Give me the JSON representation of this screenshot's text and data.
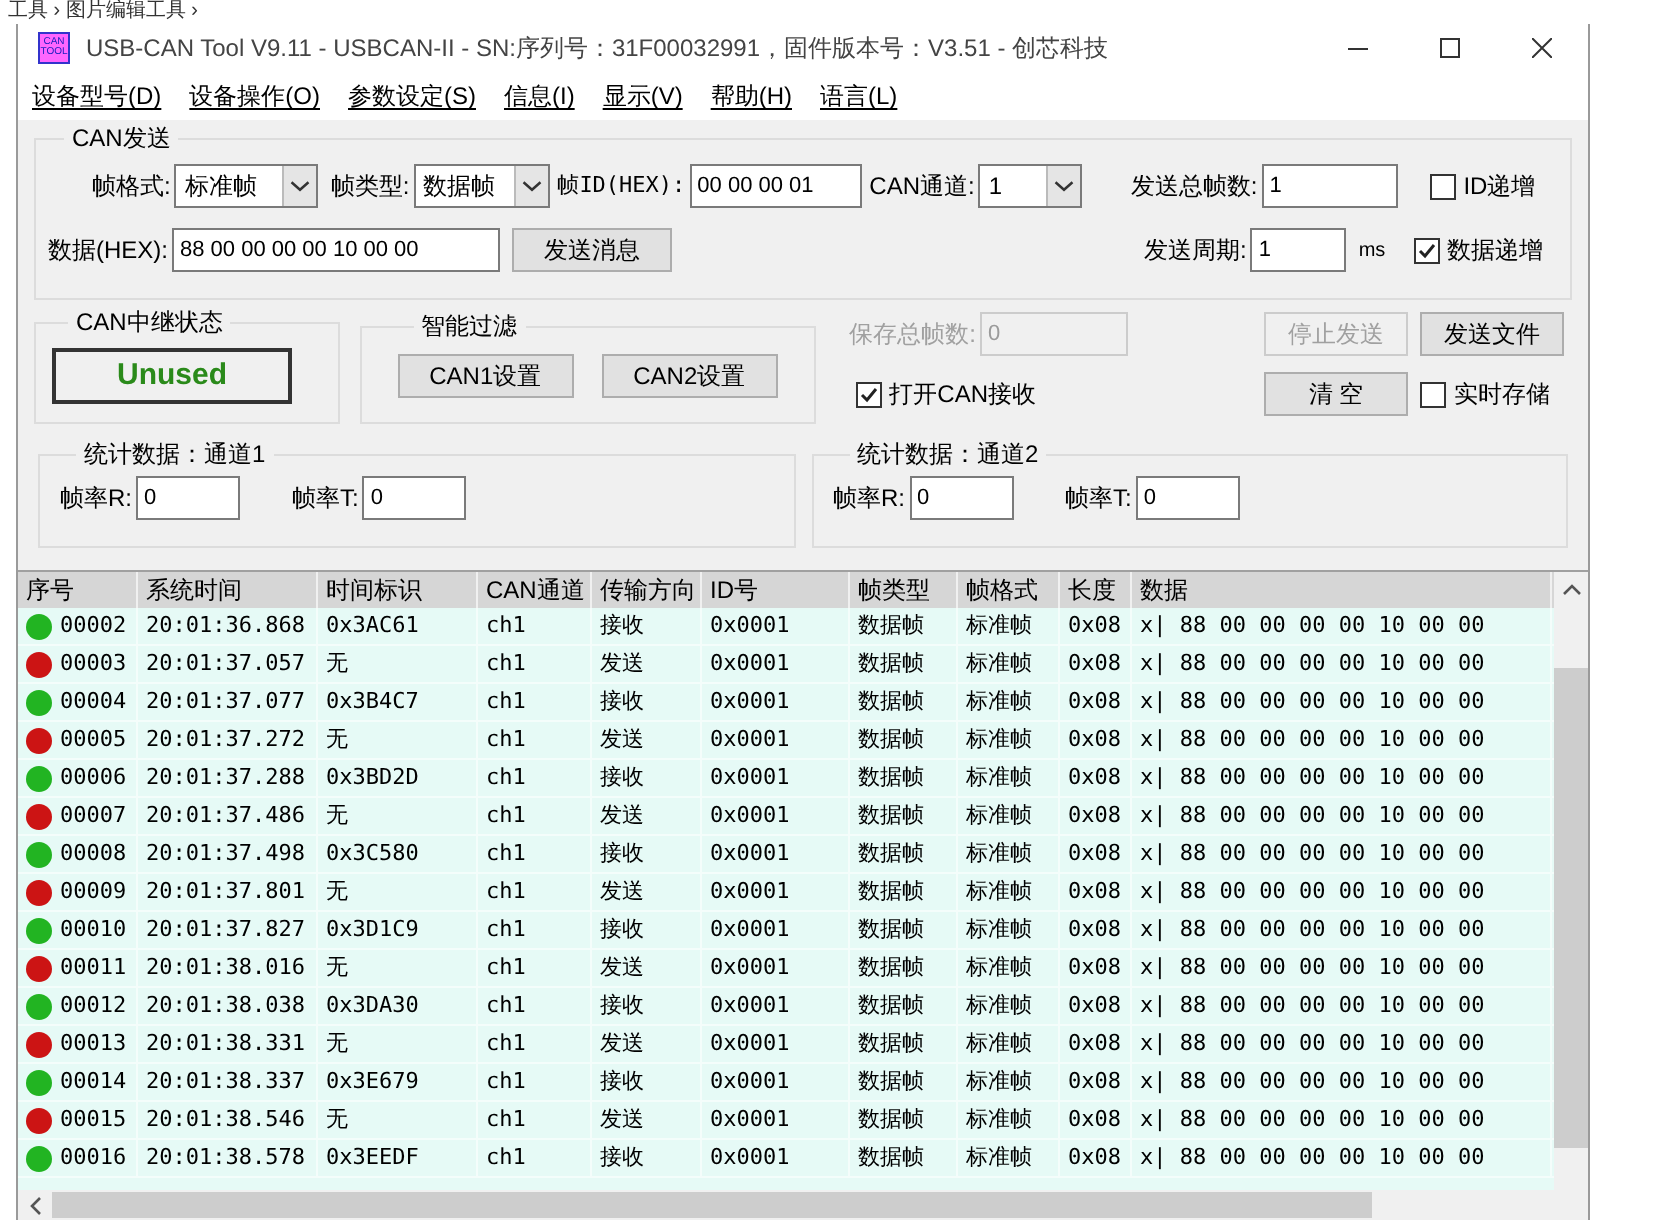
{
  "background_breadcrumb": "工具 › 图片编辑工具 ›",
  "window": {
    "title": "USB-CAN Tool V9.11 - USBCAN-II - SN:序列号：31F00032991，固件版本号：V3.51 - 创芯科技",
    "logo": "CAN TOOL"
  },
  "menu": [
    "设备型号(D)",
    "设备操作(O)",
    "参数设定(S)",
    "信息(I)",
    "显示(V)",
    "帮助(H)",
    "语言(L)"
  ],
  "can_send": {
    "title": "CAN发送",
    "frame_format": {
      "label": "帧格式:",
      "value": "标准帧"
    },
    "frame_type": {
      "label": "帧类型:",
      "value": "数据帧"
    },
    "frame_id": {
      "label": "帧ID(HEX):",
      "value": "00 00 00 01"
    },
    "channel": {
      "label": "CAN通道:",
      "value": "1"
    },
    "total_frames": {
      "label": "发送总帧数:",
      "value": "1"
    },
    "id_increment": {
      "label": "ID递增",
      "checked": false
    },
    "data": {
      "label": "数据(HEX):",
      "value": "88 00 00 00 00 10 00 00"
    },
    "send_button": "发送消息",
    "period": {
      "label": "发送周期:",
      "value": "1",
      "unit": "ms"
    },
    "data_increment": {
      "label": "数据递增",
      "checked": true
    }
  },
  "relay": {
    "title": "CAN中继状态",
    "status": "Unused"
  },
  "filter": {
    "title": "智能过滤",
    "buttons": [
      "CAN1设置",
      "CAN2设置"
    ]
  },
  "save_total": {
    "label": "保存总帧数:",
    "value": "0",
    "disabled": true
  },
  "stop_send": {
    "label": "停止发送",
    "disabled": true
  },
  "send_file": "发送文件",
  "open_receive": {
    "label": "打开CAN接收",
    "checked": true
  },
  "clear": "清 空",
  "realtime_save": {
    "label": "实时存储",
    "checked": false
  },
  "stats": [
    {
      "title": "统计数据：通道1",
      "r_label": "帧率R:",
      "r_value": "0",
      "t_label": "帧率T:",
      "t_value": "0"
    },
    {
      "title": "统计数据：通道2",
      "r_label": "帧率R:",
      "r_value": "0",
      "t_label": "帧率T:",
      "t_value": "0"
    }
  ],
  "table": {
    "columns": [
      "序号",
      "系统时间",
      "时间标识",
      "CAN通道",
      "传输方向",
      "ID号",
      "帧类型",
      "帧格式",
      "长度",
      "数据"
    ],
    "rows": [
      {
        "color": "#22b422",
        "cells": [
          "00002",
          "20:01:36.868",
          "0x3AC61",
          "ch1",
          "接收",
          "0x0001",
          "数据帧",
          "标准帧",
          "0x08",
          "x| 88 00 00 00 00 10 00 00"
        ]
      },
      {
        "color": "#cc1414",
        "cells": [
          "00003",
          "20:01:37.057",
          "无",
          "ch1",
          "发送",
          "0x0001",
          "数据帧",
          "标准帧",
          "0x08",
          "x| 88 00 00 00 00 10 00 00"
        ]
      },
      {
        "color": "#22b422",
        "cells": [
          "00004",
          "20:01:37.077",
          "0x3B4C7",
          "ch1",
          "接收",
          "0x0001",
          "数据帧",
          "标准帧",
          "0x08",
          "x| 88 00 00 00 00 10 00 00"
        ]
      },
      {
        "color": "#cc1414",
        "cells": [
          "00005",
          "20:01:37.272",
          "无",
          "ch1",
          "发送",
          "0x0001",
          "数据帧",
          "标准帧",
          "0x08",
          "x| 88 00 00 00 00 10 00 00"
        ]
      },
      {
        "color": "#22b422",
        "cells": [
          "00006",
          "20:01:37.288",
          "0x3BD2D",
          "ch1",
          "接收",
          "0x0001",
          "数据帧",
          "标准帧",
          "0x08",
          "x| 88 00 00 00 00 10 00 00"
        ]
      },
      {
        "color": "#cc1414",
        "cells": [
          "00007",
          "20:01:37.486",
          "无",
          "ch1",
          "发送",
          "0x0001",
          "数据帧",
          "标准帧",
          "0x08",
          "x| 88 00 00 00 00 10 00 00"
        ]
      },
      {
        "color": "#22b422",
        "cells": [
          "00008",
          "20:01:37.498",
          "0x3C580",
          "ch1",
          "接收",
          "0x0001",
          "数据帧",
          "标准帧",
          "0x08",
          "x| 88 00 00 00 00 10 00 00"
        ]
      },
      {
        "color": "#cc1414",
        "cells": [
          "00009",
          "20:01:37.801",
          "无",
          "ch1",
          "发送",
          "0x0001",
          "数据帧",
          "标准帧",
          "0x08",
          "x| 88 00 00 00 00 10 00 00"
        ]
      },
      {
        "color": "#22b422",
        "cells": [
          "00010",
          "20:01:37.827",
          "0x3D1C9",
          "ch1",
          "接收",
          "0x0001",
          "数据帧",
          "标准帧",
          "0x08",
          "x| 88 00 00 00 00 10 00 00"
        ]
      },
      {
        "color": "#cc1414",
        "cells": [
          "00011",
          "20:01:38.016",
          "无",
          "ch1",
          "发送",
          "0x0001",
          "数据帧",
          "标准帧",
          "0x08",
          "x| 88 00 00 00 00 10 00 00"
        ]
      },
      {
        "color": "#22b422",
        "cells": [
          "00012",
          "20:01:38.038",
          "0x3DA30",
          "ch1",
          "接收",
          "0x0001",
          "数据帧",
          "标准帧",
          "0x08",
          "x| 88 00 00 00 00 10 00 00"
        ]
      },
      {
        "color": "#cc1414",
        "cells": [
          "00013",
          "20:01:38.331",
          "无",
          "ch1",
          "发送",
          "0x0001",
          "数据帧",
          "标准帧",
          "0x08",
          "x| 88 00 00 00 00 10 00 00"
        ]
      },
      {
        "color": "#22b422",
        "cells": [
          "00014",
          "20:01:38.337",
          "0x3E679",
          "ch1",
          "接收",
          "0x0001",
          "数据帧",
          "标准帧",
          "0x08",
          "x| 88 00 00 00 00 10 00 00"
        ]
      },
      {
        "color": "#cc1414",
        "cells": [
          "00015",
          "20:01:38.546",
          "无",
          "ch1",
          "发送",
          "0x0001",
          "数据帧",
          "标准帧",
          "0x08",
          "x| 88 00 00 00 00 10 00 00"
        ]
      },
      {
        "color": "#22b422",
        "cells": [
          "00016",
          "20:01:38.578",
          "0x3EEDF",
          "ch1",
          "接收",
          "0x0001",
          "数据帧",
          "标准帧",
          "0x08",
          "x| 88 00 00 00 00 10 00 00"
        ]
      }
    ]
  }
}
